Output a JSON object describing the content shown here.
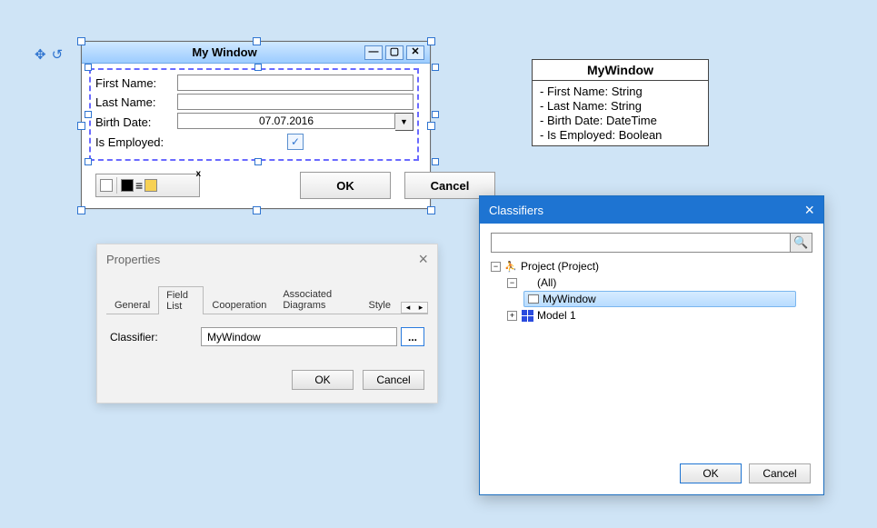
{
  "mywindow": {
    "title": "My Window",
    "fields": {
      "first_name": "First Name:",
      "last_name": "Last Name:",
      "birth_date": "Birth Date:",
      "birth_date_value": "07.07.2016",
      "is_employed": "Is Employed:"
    },
    "ok": "OK",
    "cancel": "Cancel"
  },
  "uml": {
    "class_name": "MyWindow",
    "attrs": [
      "- First Name: String",
      "- Last Name: String",
      "- Birth Date: DateTime",
      "- Is Employed: Boolean"
    ]
  },
  "props": {
    "title": "Properties",
    "tabs": {
      "general": "General",
      "fieldlist": "Field List",
      "cooperation": "Cooperation",
      "associated": "Associated Diagrams",
      "style": "Style"
    },
    "classifier_label": "Classifier:",
    "classifier_value": "MyWindow",
    "ellipsis": "...",
    "ok": "OK",
    "cancel": "Cancel"
  },
  "clsf": {
    "title": "Classifiers",
    "search_placeholder": "",
    "tree": {
      "root": "Project (Project)",
      "all": "(All)",
      "mywindow": "MyWindow",
      "model1": "Model 1"
    },
    "ok": "OK",
    "cancel": "Cancel"
  }
}
